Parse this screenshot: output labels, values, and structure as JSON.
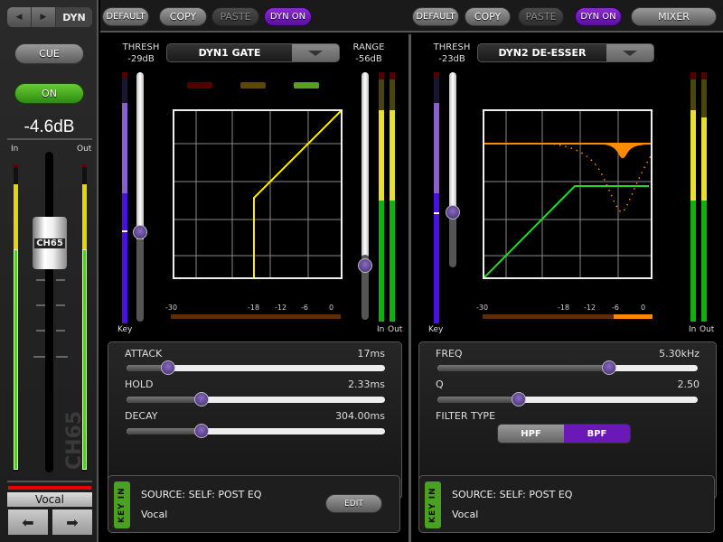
{
  "strip": {
    "nav_label": "DYN",
    "cue_label": "CUE",
    "on_label": "ON",
    "fader_level": "-4.6dB",
    "in_label": "In",
    "out_label": "Out",
    "channel": "CH65",
    "channel_name": "Vocal",
    "in_meter_level_pct": 72,
    "out_meter_level_pct": 72
  },
  "topbar": {
    "left": {
      "default": "DEFAULT",
      "copy": "COPY",
      "paste": "PASTE",
      "dyn_on": "DYN ON"
    },
    "right": {
      "default": "DEFAULT",
      "copy": "COPY",
      "paste": "PASTE",
      "dyn_on": "DYN ON",
      "mixer": "MIXER"
    }
  },
  "dyn1": {
    "thresh_label": "THRESH",
    "thresh_value": "-29dB",
    "type": "DYN1 GATE",
    "range_label": "RANGE",
    "range_value": "-56dB",
    "key_label": "Key",
    "in_label": "In",
    "out_label": "Out",
    "gr_scale": [
      "-30",
      "-18",
      "-12",
      "-6",
      "0"
    ],
    "gr_amount_pct": 0,
    "params": [
      {
        "label": "ATTACK",
        "value": "17ms",
        "pos_pct": 15
      },
      {
        "label": "HOLD",
        "value": "2.33ms",
        "pos_pct": 29
      },
      {
        "label": "DECAY",
        "value": "304.00ms",
        "pos_pct": 29
      }
    ],
    "key_in": {
      "tag": "KEY IN",
      "source": "SOURCE:  SELF: POST EQ",
      "name": "Vocal",
      "edit": "EDIT"
    }
  },
  "dyn2": {
    "thresh_label": "THRESH",
    "thresh_value": "-23dB",
    "type": "DYN2 DE-ESSER",
    "key_label": "Key",
    "in_label": "In",
    "out_label": "Out",
    "gr_scale": [
      "-30",
      "-18",
      "-12",
      "-6",
      "0"
    ],
    "gr_amount_pct": 23,
    "params": [
      {
        "label": "FREQ",
        "value": "5.30kHz",
        "pos_pct": 65
      },
      {
        "label": "Q",
        "value": "2.50",
        "pos_pct": 31
      }
    ],
    "filter_type_label": "FILTER TYPE",
    "filter_options": [
      "HPF",
      "BPF"
    ],
    "filter_selected": "BPF",
    "key_in": {
      "tag": "KEY IN",
      "source": "SOURCE:  SELF: POST EQ",
      "name": "Vocal"
    }
  },
  "colors": {
    "accent": "#6a18b8",
    "on_green": "#4aa020",
    "gate_curve": "#ffee00",
    "deesser_curve": "#22dd22",
    "deesser_eq": "#ff8c00"
  }
}
